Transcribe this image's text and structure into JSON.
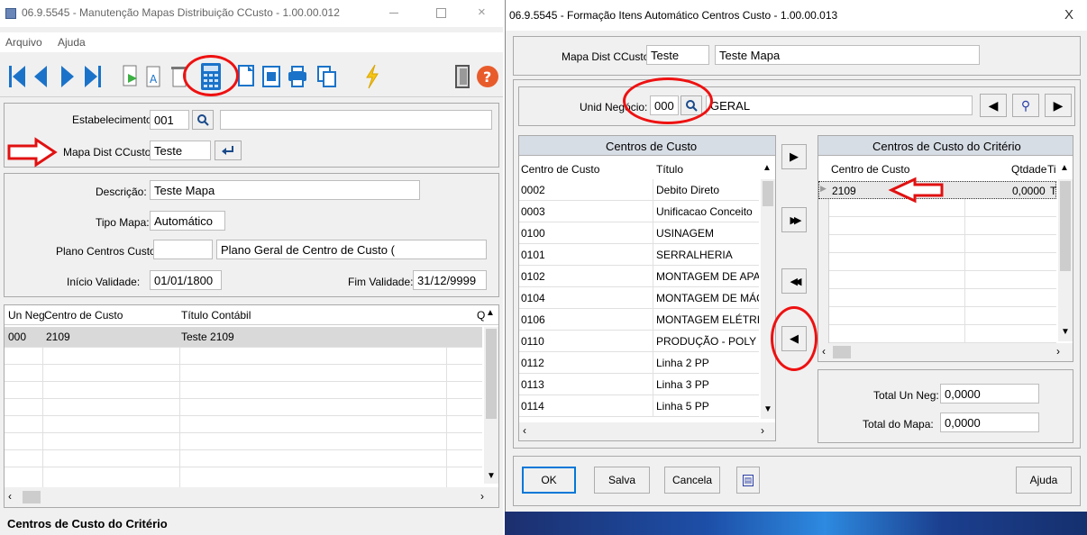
{
  "left_window": {
    "title": "06.9.5545 - Manutenção Mapas Distribuição CCusto - 1.00.00.012",
    "menu": [
      "Arquivo",
      "Ajuda"
    ],
    "estabelecimento_label": "Estabelecimento:",
    "estabelecimento_value": "001",
    "mapa_label": "Mapa Dist CCusto:",
    "mapa_value": "Teste",
    "descricao_label": "Descrição:",
    "descricao_value": "Teste Mapa",
    "tipo_label": "Tipo Mapa:",
    "tipo_value": "Automático",
    "plano_label": "Plano Centros Custo:",
    "plano_desc": "Plano Geral de Centro de Custo (",
    "inicio_label": "Início Validade:",
    "inicio_value": "01/01/1800",
    "fim_label": "Fim Validade:",
    "fim_value": "31/12/9999",
    "grid": {
      "headers": [
        "Un Neg",
        "Centro de Custo",
        "Título Contábil",
        "Q"
      ],
      "rows": [
        [
          "000",
          "2109",
          "Teste 2109"
        ]
      ]
    },
    "status": "Centros de Custo do Critério"
  },
  "right_window": {
    "title": "06.9.5545 - Formação Itens Automático Centros Custo - 1.00.00.013",
    "close": "X",
    "mapa_label": "Mapa Dist CCusto:",
    "mapa_value": "Teste",
    "mapa_desc": "Teste Mapa",
    "unid_label": "Unid Negócio:",
    "unid_value": "000",
    "unid_desc": "GERAL",
    "left_grid": {
      "title": "Centros de Custo",
      "headers": [
        "Centro de Custo",
        "Título"
      ],
      "rows": [
        [
          "0002",
          "Debito Direto"
        ],
        [
          "0003",
          "Unificacao Conceito"
        ],
        [
          "0100",
          "USINAGEM"
        ],
        [
          "0101",
          "SERRALHERIA"
        ],
        [
          "0102",
          "MONTAGEM DE APA"
        ],
        [
          "0104",
          "MONTAGEM DE MÁQ"
        ],
        [
          "0106",
          "MONTAGEM ELÉTRI"
        ],
        [
          "0110",
          "PRODUÇÃO - POLY"
        ],
        [
          "0112",
          "Linha 2 PP"
        ],
        [
          "0113",
          "Linha 3 PP"
        ],
        [
          "0114",
          "Linha 5 PP"
        ]
      ]
    },
    "right_grid": {
      "title": "Centros de Custo do Critério",
      "headers": [
        "Centro de Custo",
        "Qtdade",
        "Ti"
      ],
      "rows": [
        [
          "2109",
          "0,0000",
          "T"
        ]
      ]
    },
    "total_un_label": "Total Un Neg:",
    "total_un_value": "0,0000",
    "total_mapa_label": "Total do Mapa:",
    "total_mapa_value": "0,0000",
    "buttons": {
      "ok": "OK",
      "salva": "Salva",
      "cancela": "Cancela",
      "ajuda": "Ajuda"
    }
  },
  "colors": {
    "annotation_red": "#e11111",
    "toolbar_blue": "#1a73c9"
  }
}
